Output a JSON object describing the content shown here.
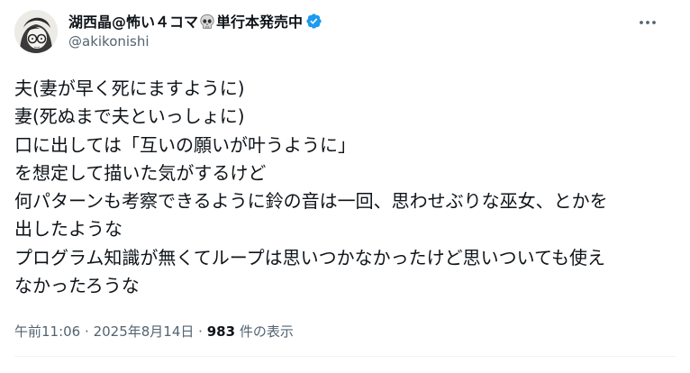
{
  "author": {
    "name_prefix": "湖西晶@怖い４コマ",
    "name_suffix": "単行本発売中",
    "handle": "@akikonishi",
    "name_icon": "skull-icon",
    "verified_icon": "verified-badge-icon"
  },
  "tweet": {
    "lines": [
      "夫(妻が早く死にますように)",
      "妻(死ぬまで夫といっしょに)",
      "口に出しては「互いの願いが叶うように」",
      "を想定して描いた気がするけど",
      "何パターンも考察できるように鈴の音は一回、思わせぶりな巫女、とかを",
      "出したような",
      "プログラム知識が無くてループは思いつかなかったけど思いついても使え",
      "なかったろうな"
    ]
  },
  "meta": {
    "time": "午前11:06",
    "separator": "·",
    "date": "2025年8月14日",
    "views_count": "983",
    "views_label": "件の表示"
  },
  "colors": {
    "text": "#0f1419",
    "secondary": "#536471",
    "verified": "#1d9bf0",
    "divider": "#eff3f4"
  }
}
